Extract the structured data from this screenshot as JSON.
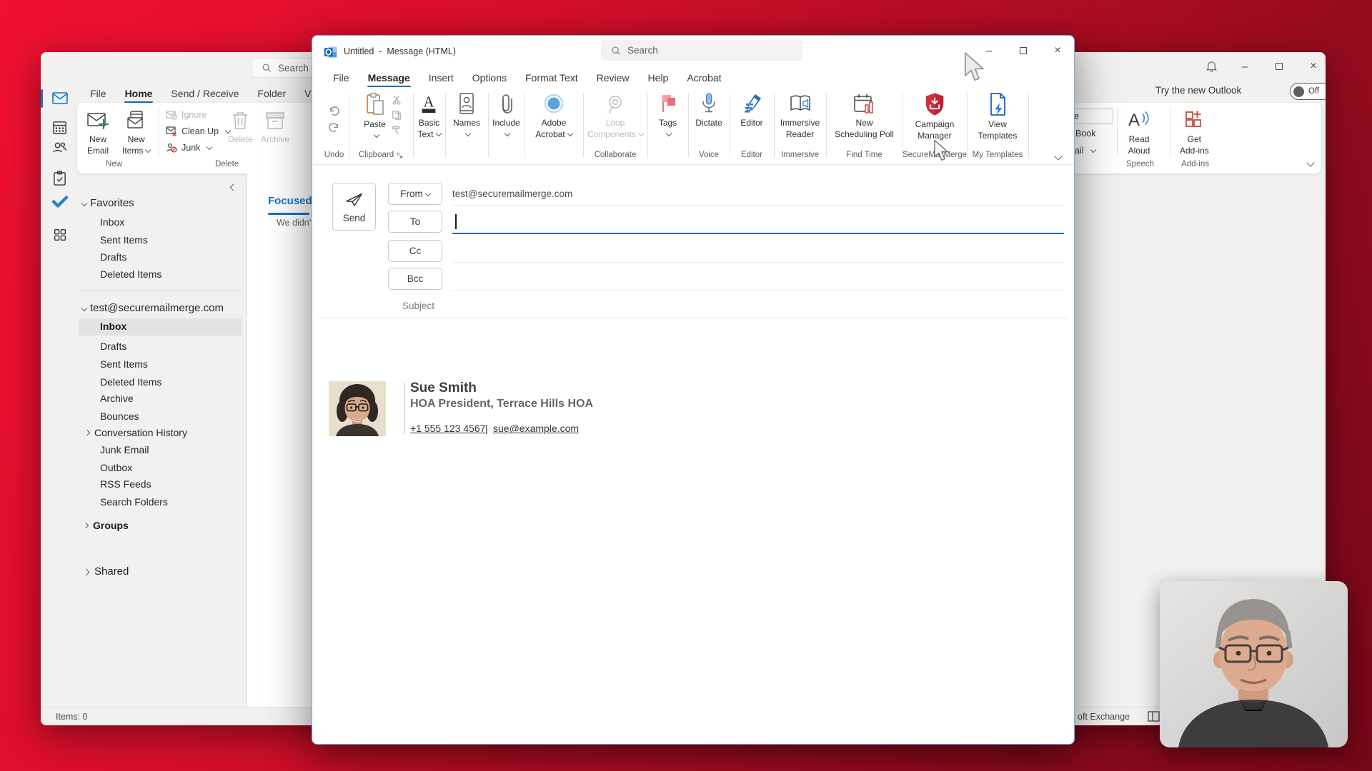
{
  "background_window": {
    "search_placeholder": "Search",
    "tabs": [
      "File",
      "Home",
      "Send / Receive",
      "Folder",
      "View"
    ],
    "try_new_outlook": {
      "label": "Try the new Outlook",
      "state": "Off"
    },
    "ribbon": {
      "new_email": {
        "l1": "New",
        "l2": "Email"
      },
      "new_items": {
        "l1": "New",
        "l2": "Items"
      },
      "ignore": "Ignore",
      "clean_up": "Clean Up",
      "junk": "Junk",
      "delete": "Delete",
      "archive": "Archive",
      "read_aloud": {
        "l1": "Read",
        "l2": "Aloud"
      },
      "get_addins": {
        "l1": "Get",
        "l2": "Add-ins"
      },
      "fragments": {
        "people_box": "le",
        "address_book": "Book",
        "filter_email": "ail"
      },
      "groups": {
        "new": "New",
        "delete": "Delete",
        "speech": "Speech",
        "addins": "Add-ins"
      }
    },
    "folder_pane": {
      "favorites": "Favorites",
      "fav_items": [
        "Inbox",
        "Sent Items",
        "Drafts",
        "Deleted Items"
      ],
      "account": "test@securemailmerge.com",
      "account_items": [
        "Inbox",
        "Drafts",
        "Sent Items",
        "Deleted Items",
        "Archive",
        "Bounces",
        "Conversation History",
        "Junk Email",
        "Outbox",
        "RSS Feeds",
        "Search Folders"
      ],
      "groups": "Groups",
      "shared": "Shared"
    },
    "list_pane": {
      "focused": "Focused",
      "empty_fragment": "We didn't"
    },
    "status": {
      "items": "Items: 0",
      "connection_fragment": "oft Exchange"
    }
  },
  "compose_window": {
    "title": "Untitled  -  Message (HTML)",
    "search_placeholder": "Search",
    "tabs": [
      "File",
      "Message",
      "Insert",
      "Options",
      "Format Text",
      "Review",
      "Help",
      "Acrobat"
    ],
    "ribbon": {
      "paste": "Paste",
      "basic_text": {
        "l1": "Basic",
        "l2": "Text"
      },
      "names": "Names",
      "include": "Include",
      "adobe": {
        "l1": "Adobe",
        "l2": "Acrobat"
      },
      "loop": {
        "l1": "Loop",
        "l2": "Components"
      },
      "tags": "Tags",
      "dictate": "Dictate",
      "editor": "Editor",
      "immersive": {
        "l1": "Immersive",
        "l2": "Reader"
      },
      "scheduling": {
        "l1": "New",
        "l2": "Scheduling Poll"
      },
      "campaign": {
        "l1": "Campaign",
        "l2": "Manager"
      },
      "templates": {
        "l1": "View",
        "l2": "Templates"
      },
      "groups": {
        "undo": "Undo",
        "clipboard": "Clipboard",
        "collaborate": "Collaborate",
        "voice": "Voice",
        "editor": "Editor",
        "immersive": "Immersive",
        "find_time": "Find Time",
        "securemailmerge": "SecureMailMerge",
        "my_templates": "My Templates"
      }
    },
    "fields": {
      "send": "Send",
      "from": "From",
      "from_value": "test@securemailmerge.com",
      "to": "To",
      "cc": "Cc",
      "bcc": "Bcc",
      "subject": "Subject"
    },
    "signature": {
      "name": "Sue Smith",
      "title": "HOA President, Terrace Hills HOA",
      "phone": "+1 555 123 4567",
      "separator": "|",
      "email": "sue@example.com"
    }
  },
  "colors": {
    "accent_blue": "#0f6cbd",
    "shield_red": "#cf2e3c",
    "flag_red": "#ee6c79",
    "disabled_gray": "#bdbbb9"
  }
}
